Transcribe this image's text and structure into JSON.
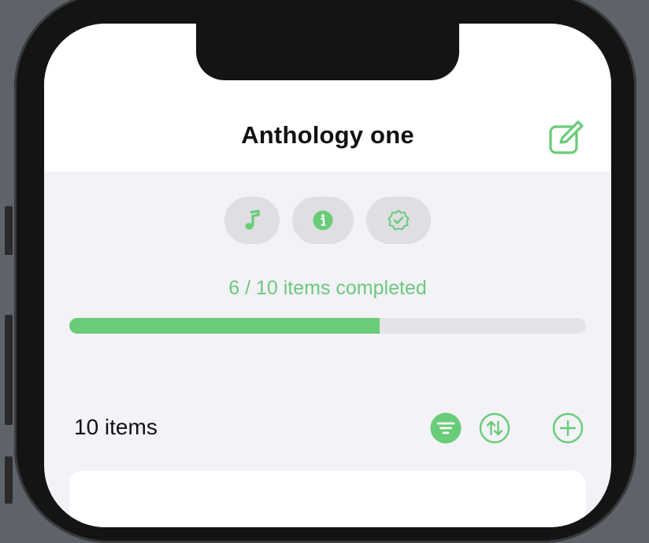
{
  "nav": {
    "title": "Anthology one",
    "edit_icon": "square-and-pencil-icon"
  },
  "chips": [
    {
      "icon": "music-note-icon"
    },
    {
      "icon": "info-circle-icon"
    },
    {
      "icon": "checkmark-seal-icon"
    }
  ],
  "progress": {
    "text": "6 / 10 items completed",
    "completed": 6,
    "total": 10,
    "fraction": 0.6
  },
  "list_header": {
    "count_label": "10 items",
    "filter_icon": "filter-icon",
    "sort_icon": "sort-arrows-icon",
    "add_icon": "plus-circle-icon"
  },
  "colors": {
    "accent": "#69cc78",
    "accent_text": "#6cc97b",
    "chip_bg": "#dedee3",
    "background": "#f2f2f7",
    "track": "#e3e3e8"
  }
}
